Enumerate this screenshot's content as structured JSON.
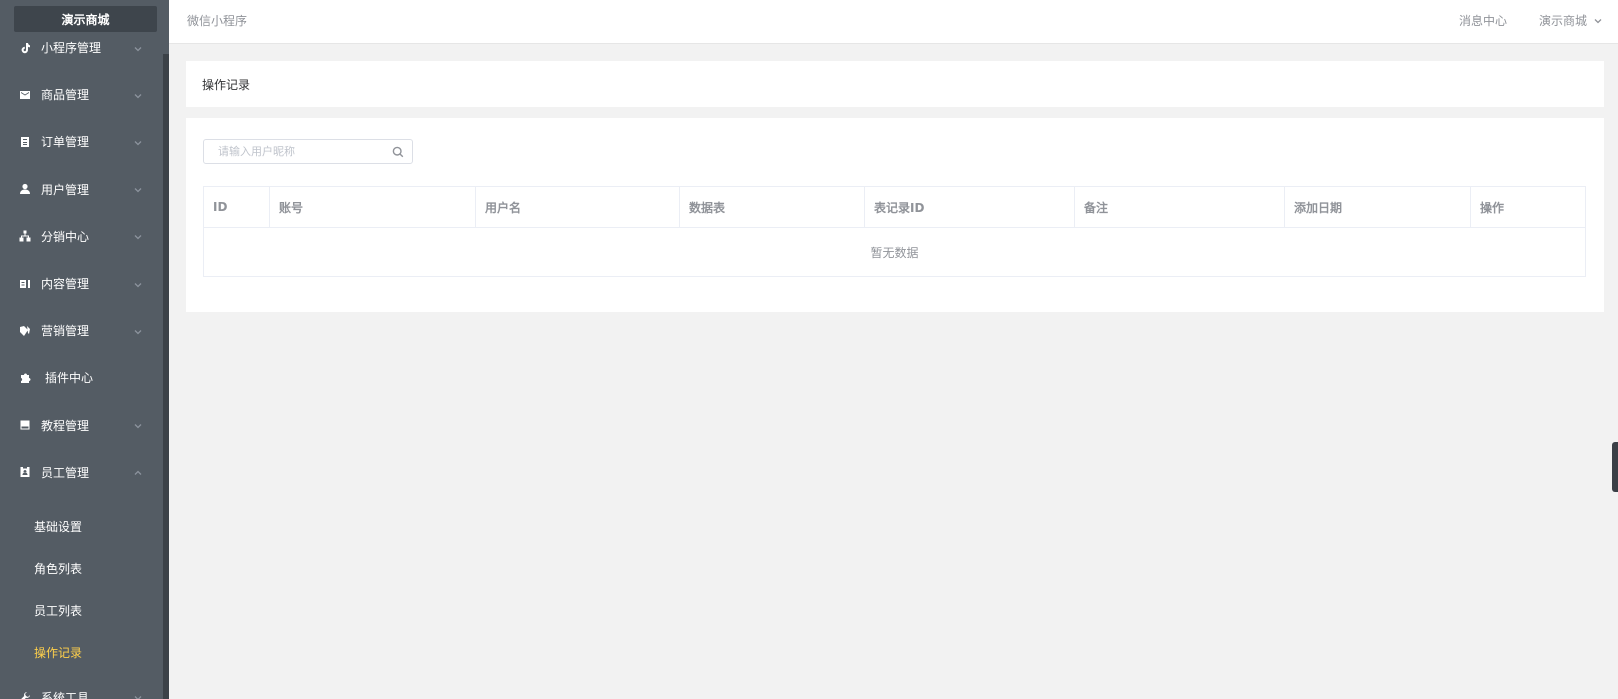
{
  "sidebar": {
    "brand": "演示商城",
    "items": [
      {
        "label": "小程序管理",
        "icon": "tiktok-icon",
        "expanded": false
      },
      {
        "label": "商品管理",
        "icon": "mail-icon",
        "expanded": false
      },
      {
        "label": "订单管理",
        "icon": "clipboard-icon",
        "expanded": false
      },
      {
        "label": "用户管理",
        "icon": "user-icon",
        "expanded": false
      },
      {
        "label": "分销中心",
        "icon": "sitemap-icon",
        "expanded": false
      },
      {
        "label": "内容管理",
        "icon": "content-icon",
        "expanded": false
      },
      {
        "label": "营销管理",
        "icon": "tags-icon",
        "expanded": false
      },
      {
        "label": "插件中心",
        "icon": "puzzle-icon",
        "expanded": false
      },
      {
        "label": "教程管理",
        "icon": "book-icon",
        "expanded": false
      },
      {
        "label": "员工管理",
        "icon": "id-badge-icon",
        "expanded": true
      }
    ],
    "subitems": [
      {
        "label": "基础设置",
        "active": false
      },
      {
        "label": "角色列表",
        "active": false
      },
      {
        "label": "员工列表",
        "active": false
      },
      {
        "label": "操作记录",
        "active": true
      }
    ],
    "next_item": "系统工具",
    "colors": {
      "background": "#545c64",
      "active": "#ffd04b"
    }
  },
  "header": {
    "breadcrumb": "微信小程序",
    "message_center": "消息中心",
    "shop_name": "演示商城"
  },
  "page": {
    "title": "操作记录"
  },
  "search": {
    "placeholder": "请输入用户昵称",
    "value": ""
  },
  "table": {
    "columns": [
      "ID",
      "账号",
      "用户名",
      "数据表",
      "表记录ID",
      "备注",
      "添加日期",
      "操作"
    ],
    "rows": [],
    "empty_text": "暂无数据"
  }
}
